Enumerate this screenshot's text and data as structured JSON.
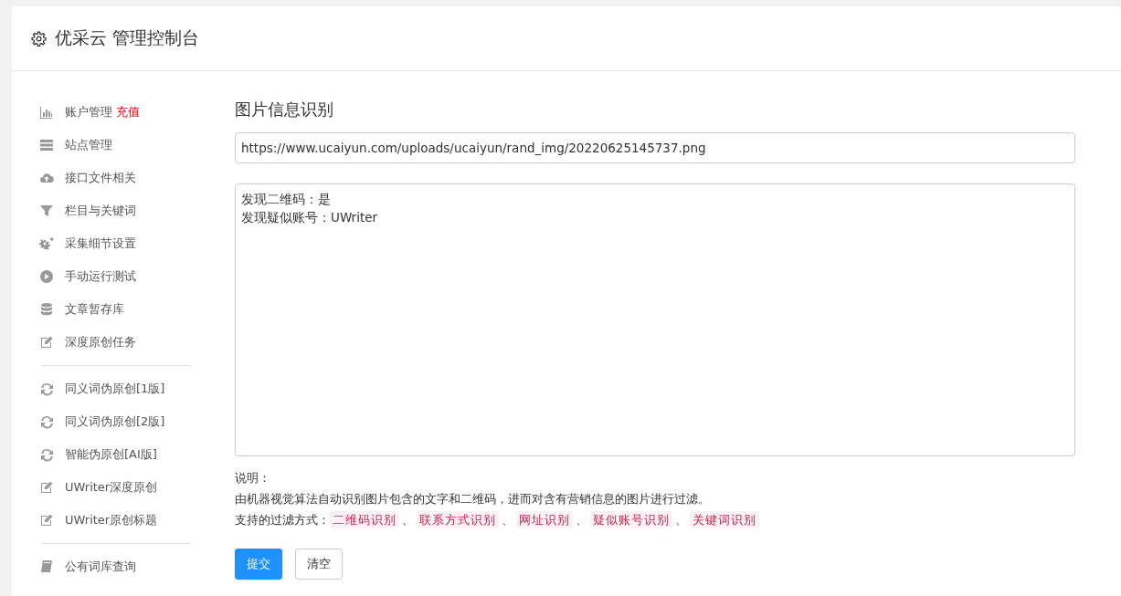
{
  "header": {
    "title": "优采云 管理控制台"
  },
  "sidebar": {
    "groups": [
      {
        "items": [
          {
            "kind": "chart",
            "label": "账户管理",
            "badge": "充值"
          },
          {
            "kind": "server",
            "label": "站点管理"
          },
          {
            "kind": "cloud",
            "label": "接口文件相关"
          },
          {
            "kind": "filter",
            "label": "栏目与关键词"
          },
          {
            "kind": "gears",
            "label": "采集细节设置"
          },
          {
            "kind": "play",
            "label": "手动运行测试"
          },
          {
            "kind": "database",
            "label": "文章暂存库"
          },
          {
            "kind": "edit",
            "label": "深度原创任务"
          }
        ]
      },
      {
        "items": [
          {
            "kind": "refresh",
            "label": "同义词伪原创[1版]"
          },
          {
            "kind": "refresh",
            "label": "同义词伪原创[2版]"
          },
          {
            "kind": "refresh",
            "label": "智能伪原创[AI版]"
          },
          {
            "kind": "edit",
            "label": "UWriter深度原创"
          },
          {
            "kind": "edit",
            "label": "UWriter原创标题"
          }
        ]
      },
      {
        "items": [
          {
            "kind": "book",
            "label": "公有词库查询"
          }
        ]
      }
    ]
  },
  "main": {
    "title": "图片信息识别",
    "url_field": {
      "value": "https://www.ucaiyun.com/uploads/ucaiyun/rand_img/20220625145737.png"
    },
    "result_box": {
      "lines": [
        "发现二维码：是",
        "发现疑似账号：UWriter"
      ]
    },
    "notes": {
      "heading": "说明：",
      "description": "由机器视觉算法自动识别图片包含的文字和二维码，进而对含有营销信息的图片进行过滤。",
      "methods_label": "支持的过滤方式：",
      "separator": "、",
      "methods": [
        "二维码识别",
        "联系方式识别",
        "网址识别",
        "疑似账号识别",
        "关键词识别"
      ]
    },
    "buttons": [
      {
        "kind": "primary",
        "label": "提交"
      },
      {
        "kind": "default",
        "label": "清空"
      }
    ]
  }
}
